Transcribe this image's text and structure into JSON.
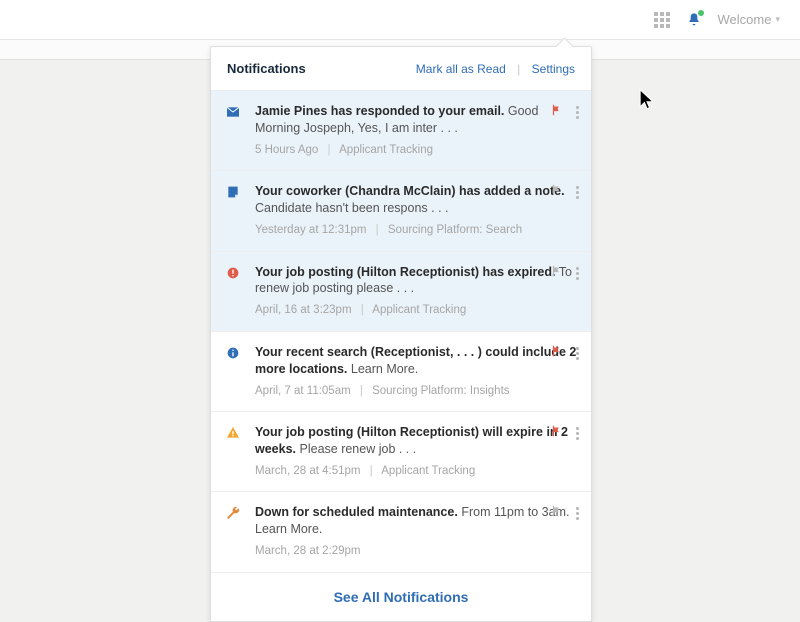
{
  "header": {
    "welcome": "Welcome"
  },
  "panel": {
    "title": "Notifications",
    "mark_read": "Mark all as Read",
    "settings": "Settings",
    "see_all": "See All Notifications"
  },
  "items": [
    {
      "bold": "Jamie Pines has responded to your email.",
      "rest": "Good Morning Jospeph, Yes, I am inter . . .",
      "time": "5 Hours Ago",
      "source": "Applicant Tracking"
    },
    {
      "bold": "Your coworker (Chandra McClain) has added a note.",
      "rest": "Candidate hasn't been respons . . .",
      "time": "Yesterday at 12:31pm",
      "source": "Sourcing Platform: Search"
    },
    {
      "bold": "Your job posting (Hilton Receptionist) has expired.",
      "rest": "To renew job posting please . . .",
      "time": "April, 16 at 3:23pm",
      "source": "Applicant Tracking"
    },
    {
      "bold": "Your recent search (Receptionist, . . . ) could include 2 more locations.",
      "rest": "Learn More.",
      "time": "April, 7 at 11:05am",
      "source": "Sourcing Platform: Insights"
    },
    {
      "bold": "Your job posting (Hilton Receptionist) will expire in 2 weeks.",
      "rest": "Please renew job  . . .",
      "time": "March, 28 at 4:51pm",
      "source": "Applicant Tracking"
    },
    {
      "bold": "Down for scheduled maintenance.",
      "rest": "From 11pm to 3am. Learn More.",
      "time": "March, 28 at 2:29pm",
      "source": ""
    }
  ]
}
